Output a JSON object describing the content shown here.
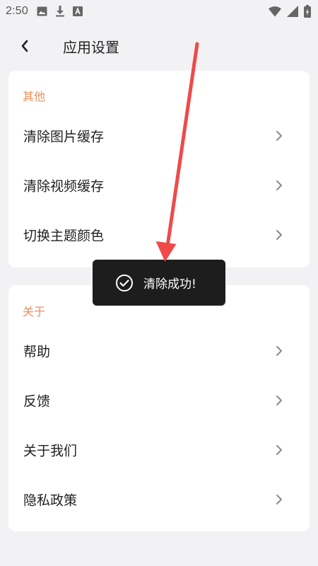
{
  "status_bar": {
    "time": "2:50",
    "left_icons": [
      "image-icon",
      "download-icon",
      "a-box-icon"
    ],
    "right_icons": [
      "wifi-icon",
      "signal-icon",
      "battery-icon"
    ]
  },
  "header": {
    "back_icon": "chevron-left-icon",
    "title": "应用设置"
  },
  "sections": {
    "other": {
      "title": "其他",
      "items": [
        {
          "label": "清除图片缓存"
        },
        {
          "label": "清除视频缓存"
        },
        {
          "label": "切换主题颜色"
        }
      ]
    },
    "about": {
      "title": "关于",
      "items": [
        {
          "label": "帮助"
        },
        {
          "label": "反馈"
        },
        {
          "label": "关于我们"
        },
        {
          "label": "隐私政策"
        }
      ]
    }
  },
  "toast": {
    "icon": "check-circle-icon",
    "text": "清除成功!"
  },
  "annotation": {
    "icon": "red-arrow-icon",
    "color": "#ef4a4a"
  },
  "colors": {
    "background": "#f2f2f4",
    "card": "#ffffff",
    "section_title": "#e9905f",
    "toast_bg": "#1d1d1d"
  }
}
